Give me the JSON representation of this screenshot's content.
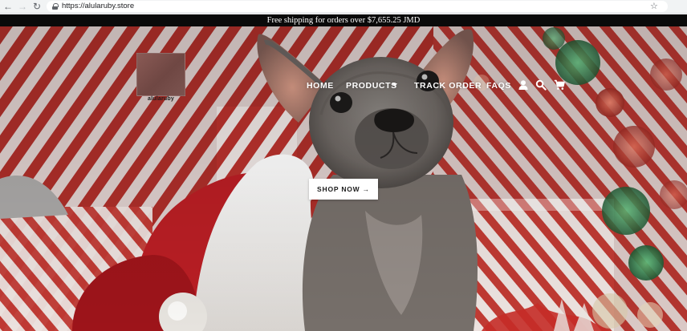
{
  "browser": {
    "url": "https://alularuby.store",
    "back_icon": "arrow-left-icon",
    "forward_icon": "arrow-right-icon",
    "reload_icon": "reload-icon",
    "secure_icon": "lock-icon",
    "bookmark_icon": "star-icon"
  },
  "announcement": {
    "text": "Free shipping for orders over $7,655.25 JMD"
  },
  "header": {
    "logo_text": "alularuby",
    "nav": {
      "home": "HOME",
      "products": "PRODUCTS",
      "track_order": "TRACK ORDER",
      "faqs": "FAQS"
    },
    "icons": [
      "user-icon",
      "search-icon",
      "cart-icon"
    ]
  },
  "hero": {
    "cta_label": "SHOP NOW →"
  },
  "colors": {
    "announcement_bg": "#0a0a0a",
    "nav_text": "#ffffff",
    "cta_bg": "#ffffff"
  }
}
